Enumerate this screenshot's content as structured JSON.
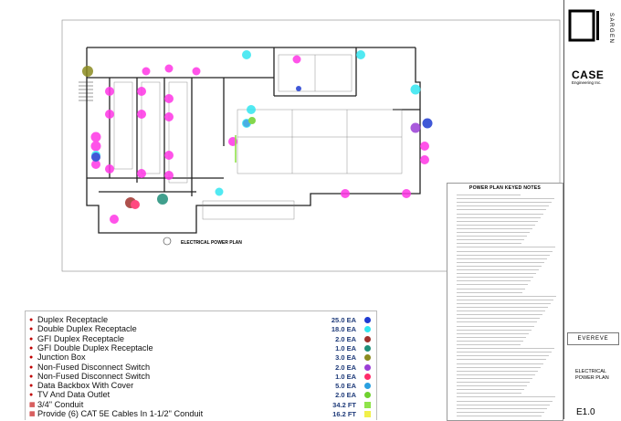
{
  "legend": {
    "items": [
      {
        "label": "Duplex Receptacle",
        "qty": "25.0 EA",
        "color": "#1f3bd1",
        "shape": "circle"
      },
      {
        "label": "Double Duplex Receptacle",
        "qty": "18.0 EA",
        "color": "#33e6f0",
        "shape": "circle"
      },
      {
        "label": "GFI Duplex Receptacle",
        "qty": "2.0 EA",
        "color": "#a0322d",
        "shape": "circle"
      },
      {
        "label": "GFI Double Duplex Receptacle",
        "qty": "1.0 EA",
        "color": "#1f8f7a",
        "shape": "circle"
      },
      {
        "label": "Junction Box",
        "qty": "3.0 EA",
        "color": "#8b8b20",
        "shape": "circle"
      },
      {
        "label": "Non-Fused Disconnect Switch",
        "qty": "2.0 EA",
        "color": "#9b3fd6",
        "shape": "circle"
      },
      {
        "label": "Non-Fused Disconnect Switch",
        "qty": "1.0 EA",
        "color": "#ff2b6a",
        "shape": "circle"
      },
      {
        "label": "Data Backbox With Cover",
        "qty": "5.0 EA",
        "color": "#2aa0e0",
        "shape": "circle"
      },
      {
        "label": "TV And Data Outlet",
        "qty": "2.0 EA",
        "color": "#6fd12f",
        "shape": "circle"
      },
      {
        "label": "3/4\" Conduit",
        "qty": "34.2 FT",
        "color": "#8fe34a",
        "shape": "square"
      },
      {
        "label": "Provide (6) CAT 5E Cables In 1-1/2\" Conduit",
        "qty": "16.2 FT",
        "color": "#f1f04a",
        "shape": "square"
      }
    ]
  },
  "notes": {
    "title": "POWER PLAN KEYED NOTES"
  },
  "plan": {
    "label": "ELECTRICAL POWER PLAN"
  },
  "title_block": {
    "logo": "SARGENTI",
    "firm": "CASE",
    "firm_sub": "Engineering Inc.",
    "client": "EVEREVE",
    "sheet_title_1": "ELECTRICAL",
    "sheet_title_2": "POWER PLAN",
    "sheet_number": "E1.0"
  }
}
